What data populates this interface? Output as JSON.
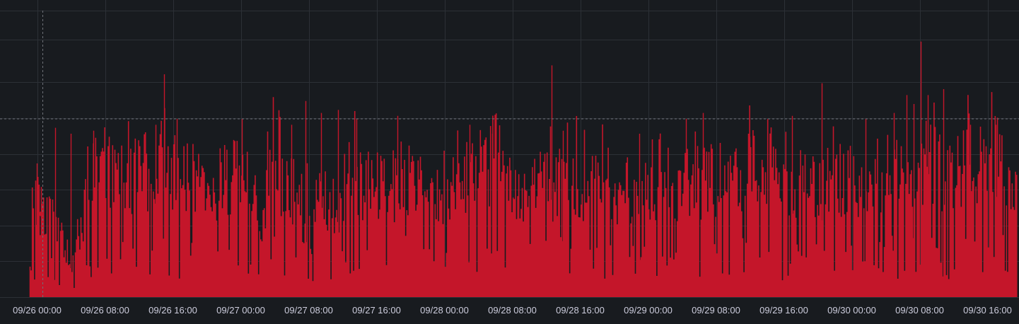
{
  "chart_data": {
    "type": "bar",
    "title": "",
    "xlabel": "",
    "ylabel": "",
    "x_tick_labels": [
      "09/26 00:00",
      "09/26 08:00",
      "09/26 16:00",
      "09/27 00:00",
      "09/27 08:00",
      "09/27 16:00",
      "09/28 00:00",
      "09/28 08:00",
      "09/28 16:00",
      "09/29 00:00",
      "09/29 08:00",
      "09/29 16:00",
      "09/30 00:00",
      "09/30 08:00",
      "09/30 16:00"
    ],
    "xlim": [
      "09/25 23:10",
      "09/30 19:30"
    ],
    "ylim": [
      0,
      1
    ],
    "y_tick_labels_shown": false,
    "grid": true,
    "legend": "none",
    "colors": {
      "background": "#181b1f",
      "grid": "#2c3036",
      "series": "#c4162a",
      "text": "#ccccdc",
      "crosshair": "#6e7178"
    },
    "threshold_line": {
      "style": "dashed",
      "value": 0.6
    },
    "crosshair": {
      "x": "09/26 00:40",
      "y": 0.28
    },
    "series": [
      {
        "values": [
          0.35,
          0.38,
          0.34,
          0.3,
          0.22,
          0.1,
          0.28,
          0.4,
          0.52,
          0.53,
          0.47,
          0.52,
          0.46,
          0.55,
          0.5,
          0.43,
          0.6,
          0.52,
          0.47,
          0.5,
          0.46,
          0.45,
          0.45,
          0.48,
          0.45,
          0.54,
          0.48,
          0.43,
          0.25,
          0.55,
          0.5,
          0.45,
          0.42,
          0.45,
          0.42,
          0.38,
          0.4,
          0.35,
          0.48,
          0.52,
          0.47,
          0.44,
          0.45,
          0.47,
          0.45,
          0.5,
          0.5,
          0.45,
          0.4,
          0.43,
          0.45,
          0.48,
          0.47,
          0.5,
          0.54,
          0.52,
          0.58,
          0.5,
          0.45,
          0.45,
          0.47,
          0.48,
          0.46,
          0.45,
          0.5,
          0.48,
          0.5,
          0.42,
          0.48,
          0.45,
          0.42,
          0.4,
          0.45,
          0.42,
          0.45,
          0.42,
          0.45,
          0.5,
          0.46,
          0.45,
          0.48,
          0.46,
          0.46,
          0.48,
          0.45,
          0.5,
          0.48,
          0.52,
          0.5,
          0.56,
          0.47,
          0.45,
          0.47,
          0.45,
          0.42,
          0.45,
          0.48,
          0.45,
          0.48,
          0.5,
          0.48,
          0.5,
          0.5,
          0.52,
          0.5,
          0.48,
          0.5,
          0.46,
          0.5,
          0.55,
          0.52,
          0.5,
          0.55,
          0.53,
          0.5,
          0.55,
          0.6,
          0.52,
          0.5,
          0.47
        ],
        "spikes": [
          {
            "x": "09/26 00:00",
            "y": 0.45
          },
          {
            "x": "09/26 02:10",
            "y": 0.57
          },
          {
            "x": "09/26 04:00",
            "y": 0.55
          },
          {
            "x": "09/26 06:40",
            "y": 0.56
          },
          {
            "x": "09/26 14:00",
            "y": 0.58
          },
          {
            "x": "09/26 15:00",
            "y": 0.75
          },
          {
            "x": "09/26 16:30",
            "y": 0.6
          },
          {
            "x": "09/27 00:10",
            "y": 0.6
          },
          {
            "x": "09/27 06:00",
            "y": 0.58
          },
          {
            "x": "09/27 07:40",
            "y": 0.66
          },
          {
            "x": "09/27 09:30",
            "y": 0.62
          },
          {
            "x": "09/27 11:30",
            "y": 0.63
          },
          {
            "x": "09/27 13:40",
            "y": 0.6
          },
          {
            "x": "09/27 18:30",
            "y": 0.61
          },
          {
            "x": "09/28 03:00",
            "y": 0.58
          },
          {
            "x": "09/28 05:40",
            "y": 0.55
          },
          {
            "x": "09/28 12:40",
            "y": 0.78
          },
          {
            "x": "09/28 14:00",
            "y": 0.56
          },
          {
            "x": "09/28 23:00",
            "y": 0.55
          },
          {
            "x": "09/29 04:30",
            "y": 0.6
          },
          {
            "x": "09/29 06:30",
            "y": 0.62
          },
          {
            "x": "09/29 12:00",
            "y": 0.54
          },
          {
            "x": "09/29 17:00",
            "y": 0.61
          },
          {
            "x": "09/29 20:30",
            "y": 0.72
          },
          {
            "x": "09/30 01:40",
            "y": 0.6
          },
          {
            "x": "09/30 05:00",
            "y": 0.62
          },
          {
            "x": "09/30 06:30",
            "y": 0.68
          },
          {
            "x": "09/30 07:20",
            "y": 0.65
          },
          {
            "x": "09/30 08:10",
            "y": 0.86
          },
          {
            "x": "09/30 09:00",
            "y": 0.68
          },
          {
            "x": "09/30 10:50",
            "y": 0.7
          },
          {
            "x": "09/30 14:00",
            "y": 0.58
          },
          {
            "x": "09/30 17:00",
            "y": 0.58
          }
        ]
      }
    ]
  }
}
